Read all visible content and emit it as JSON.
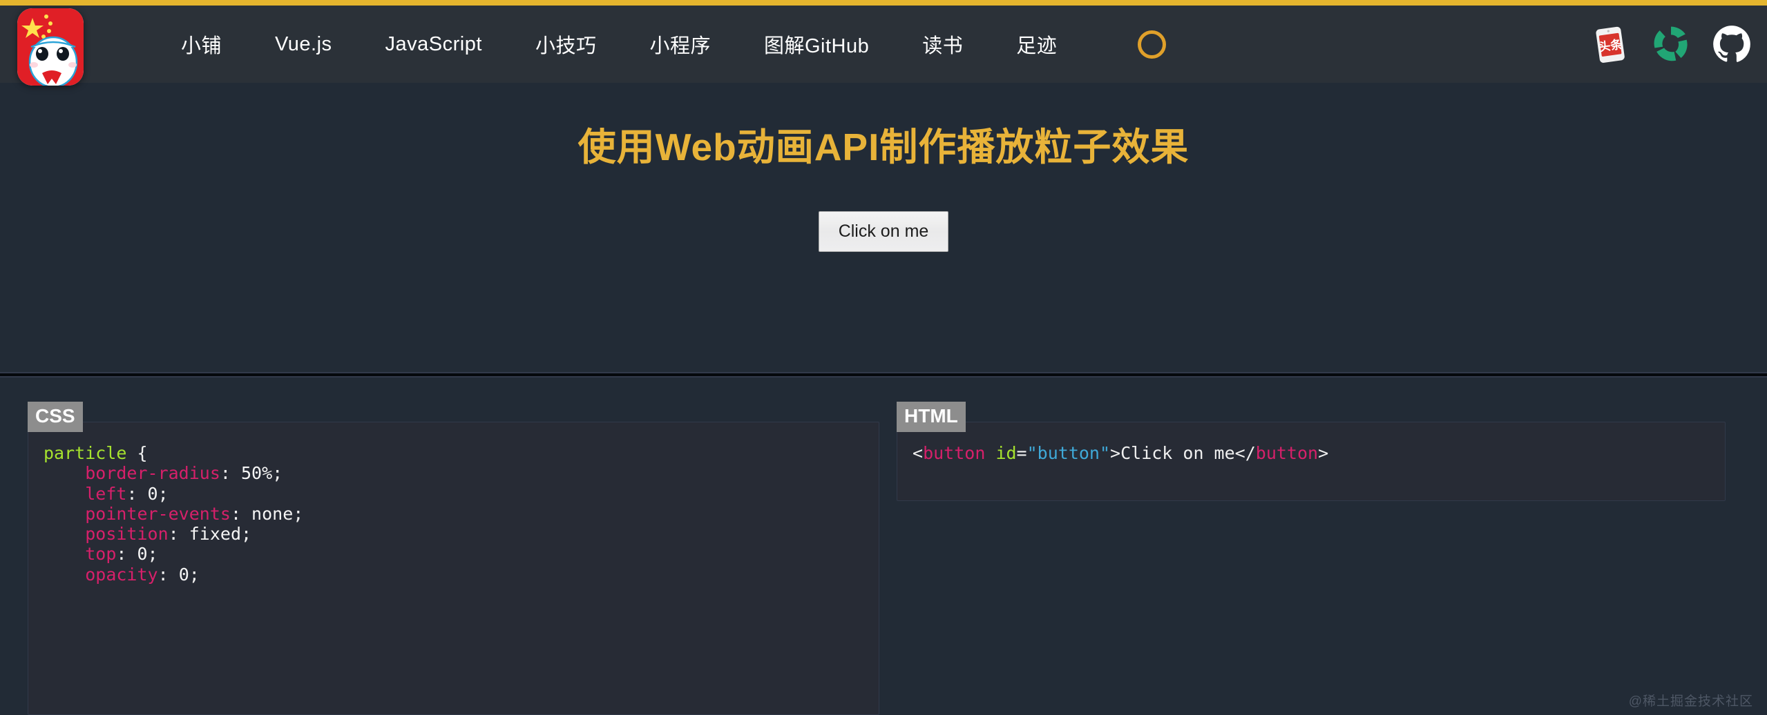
{
  "topbar": {
    "progress_color": "#e5b52e",
    "progress_percent": 100
  },
  "nav": {
    "logo_alt": "site-logo-avatar",
    "links": [
      {
        "label": "小铺"
      },
      {
        "label": "Vue.js"
      },
      {
        "label": "JavaScript"
      },
      {
        "label": "小技巧"
      },
      {
        "label": "小程序"
      },
      {
        "label": "图解GitHub"
      },
      {
        "label": "读书"
      },
      {
        "label": "足迹"
      }
    ],
    "spinner": {
      "name": "loading-spinner",
      "color": "#e0a02a"
    },
    "social": [
      {
        "name": "toutiao-icon",
        "label": "头条"
      },
      {
        "name": "segmentfault-icon",
        "label": "",
        "color": "#21a675"
      },
      {
        "name": "github-icon",
        "label": "",
        "color": "#ffffff"
      }
    ]
  },
  "hero": {
    "title": "使用Web动画API制作播放粒子效果",
    "title_color": "#e8b339",
    "button_label": "Click on me"
  },
  "code": {
    "css": {
      "badge": "CSS",
      "lines": [
        {
          "tokens": [
            {
              "t": "particle",
              "c": "tok-sel"
            },
            {
              "t": " {",
              "c": "tok-punct"
            }
          ]
        },
        {
          "tokens": [
            {
              "t": "    ",
              "c": "tok-punct"
            },
            {
              "t": "border-radius",
              "c": "tok-prop"
            },
            {
              "t": ": ",
              "c": "tok-punct"
            },
            {
              "t": "50%",
              "c": "tok-val"
            },
            {
              "t": ";",
              "c": "tok-punct"
            }
          ]
        },
        {
          "tokens": [
            {
              "t": "    ",
              "c": "tok-punct"
            },
            {
              "t": "left",
              "c": "tok-prop"
            },
            {
              "t": ": ",
              "c": "tok-punct"
            },
            {
              "t": "0",
              "c": "tok-val"
            },
            {
              "t": ";",
              "c": "tok-punct"
            }
          ]
        },
        {
          "tokens": [
            {
              "t": "    ",
              "c": "tok-punct"
            },
            {
              "t": "pointer-events",
              "c": "tok-prop"
            },
            {
              "t": ": ",
              "c": "tok-punct"
            },
            {
              "t": "none",
              "c": "tok-val"
            },
            {
              "t": ";",
              "c": "tok-punct"
            }
          ]
        },
        {
          "tokens": [
            {
              "t": "    ",
              "c": "tok-punct"
            },
            {
              "t": "position",
              "c": "tok-prop"
            },
            {
              "t": ": ",
              "c": "tok-punct"
            },
            {
              "t": "fixed",
              "c": "tok-val"
            },
            {
              "t": ";",
              "c": "tok-punct"
            }
          ]
        },
        {
          "tokens": [
            {
              "t": "    ",
              "c": "tok-punct"
            },
            {
              "t": "top",
              "c": "tok-prop"
            },
            {
              "t": ": ",
              "c": "tok-punct"
            },
            {
              "t": "0",
              "c": "tok-val"
            },
            {
              "t": ";",
              "c": "tok-punct"
            }
          ]
        },
        {
          "tokens": [
            {
              "t": "    ",
              "c": "tok-punct"
            },
            {
              "t": "opacity",
              "c": "tok-prop"
            },
            {
              "t": ": ",
              "c": "tok-punct"
            },
            {
              "t": "0",
              "c": "tok-val"
            },
            {
              "t": ";",
              "c": "tok-punct"
            }
          ]
        }
      ]
    },
    "html": {
      "badge": "HTML",
      "lines": [
        {
          "tokens": [
            {
              "t": "<",
              "c": "tok-punct"
            },
            {
              "t": "button",
              "c": "tok-tag"
            },
            {
              "t": " ",
              "c": "tok-punct"
            },
            {
              "t": "id",
              "c": "tok-attr"
            },
            {
              "t": "=",
              "c": "tok-punct"
            },
            {
              "t": "\"button\"",
              "c": "tok-string"
            },
            {
              "t": ">",
              "c": "tok-punct"
            },
            {
              "t": "Click on me",
              "c": "tok-text"
            },
            {
              "t": "</",
              "c": "tok-punct"
            },
            {
              "t": "button",
              "c": "tok-tag"
            },
            {
              "t": ">",
              "c": "tok-punct"
            }
          ]
        }
      ]
    }
  },
  "watermark": {
    "text": "@稀土掘金技术社区"
  }
}
